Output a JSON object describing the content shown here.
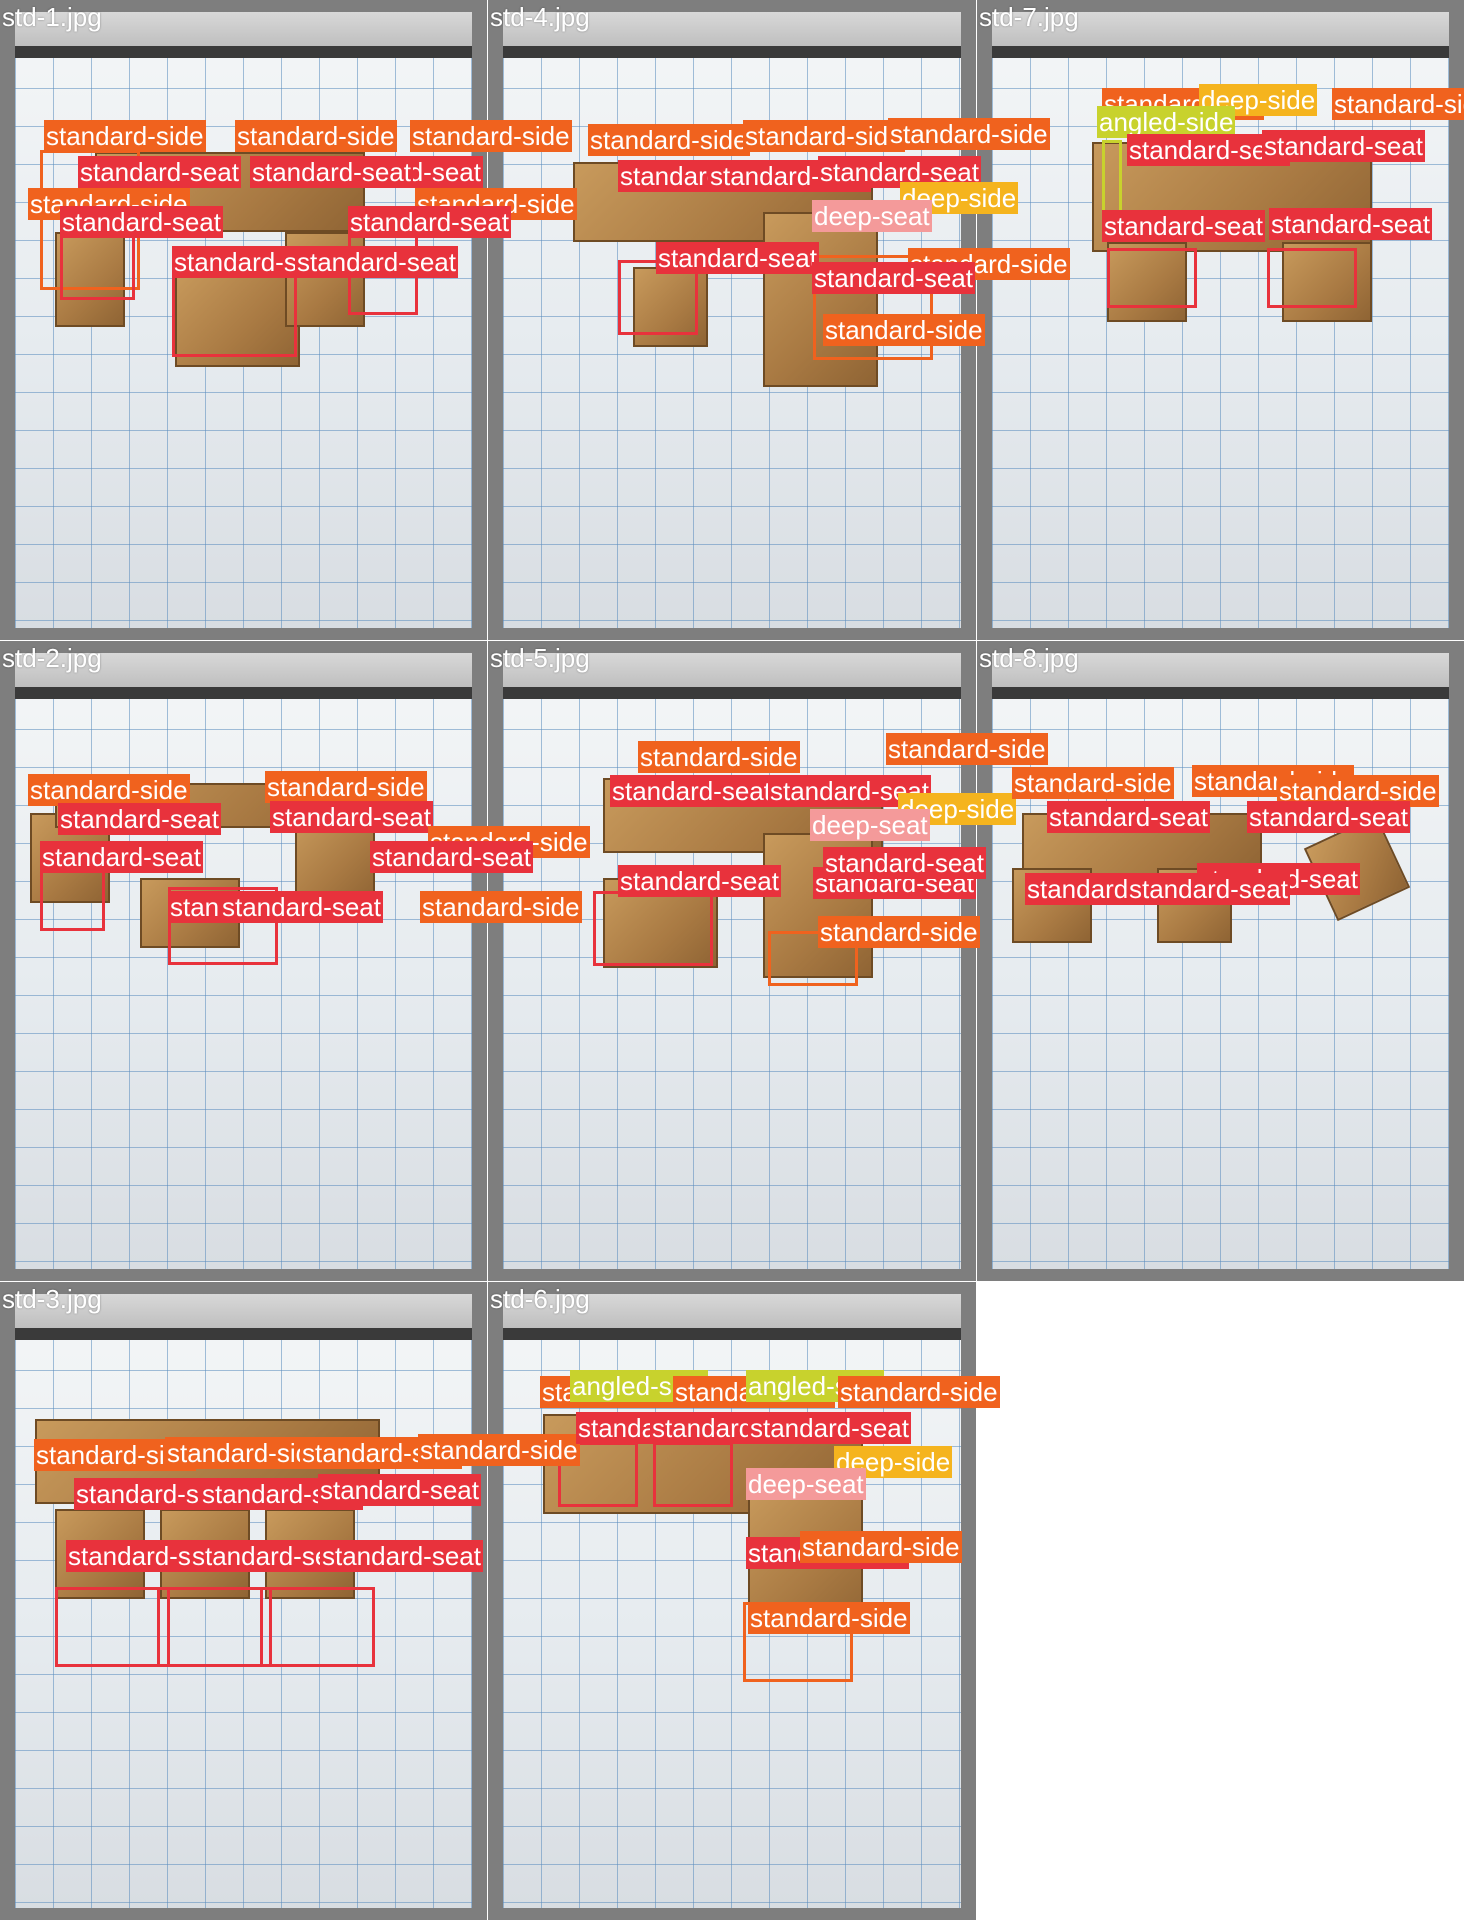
{
  "tiles": [
    {
      "title": "std-1.jpg",
      "labels": [
        "standard-side",
        "standard-side",
        "standard-side",
        "standard-side",
        "standard-side",
        "standard-seat",
        "standard-seat",
        "standard-seat",
        "standard-seat",
        "standard-seat",
        "standard-seat",
        "standard-seat"
      ]
    },
    {
      "title": "std-4.jpg",
      "labels": [
        "standard-side",
        "standard-side",
        "standard-side",
        "standard-seat",
        "standard-seat",
        "standard-seat",
        "deep-side",
        "deep-seat",
        "standard-seat",
        "standard-side",
        "standard-seat",
        "standard-side"
      ]
    },
    {
      "title": "std-7.jpg",
      "labels": [
        "standard-side",
        "deep-side",
        "standard-side",
        "angled-side",
        "standard-seat",
        "standard-seat",
        "standard-seat",
        "standard-seat"
      ]
    },
    {
      "title": "std-2.jpg",
      "labels": [
        "standard-side",
        "standard-side",
        "standard-side",
        "standard-seat",
        "standard-seat",
        "standard-seat",
        "standard-seat",
        "standard-side",
        "standard-seat",
        "standard-seat"
      ]
    },
    {
      "title": "std-5.jpg",
      "labels": [
        "standard-side",
        "standard-seat",
        "standard-seat",
        "deep-side",
        "deep-seat",
        "standard-seat",
        "standard-seat",
        "standard-side",
        "standard-seat",
        "standard-side"
      ]
    },
    {
      "title": "std-8.jpg",
      "labels": [
        "standard-side",
        "standard-side",
        "standard-side",
        "standard-seat",
        "standard-seat",
        "standard-seat",
        "standard-seat",
        "standard-seat"
      ]
    },
    {
      "title": "std-3.jpg",
      "labels": [
        "standard-side",
        "standard-side",
        "standard-side",
        "standard-side",
        "standard-seat",
        "standard-seat",
        "standard-seat",
        "standard-seat",
        "standard-seat",
        "standard-seat"
      ]
    },
    {
      "title": "std-6.jpg",
      "labels": [
        "standard-side",
        "angled-side",
        "standard-side",
        "angled-side",
        "standard-side",
        "standard-seat",
        "standard-seat",
        "standard-seat",
        "deep-side",
        "deep-seat",
        "standard-seat",
        "standard-side",
        "standard-side"
      ]
    }
  ],
  "classes": {
    "standard-seat": "#e8323c",
    "standard-side": "#f0621e",
    "deep-seat": "#f49a9a",
    "deep-side": "#f5b41e",
    "angled-side": "#c8d22d"
  }
}
